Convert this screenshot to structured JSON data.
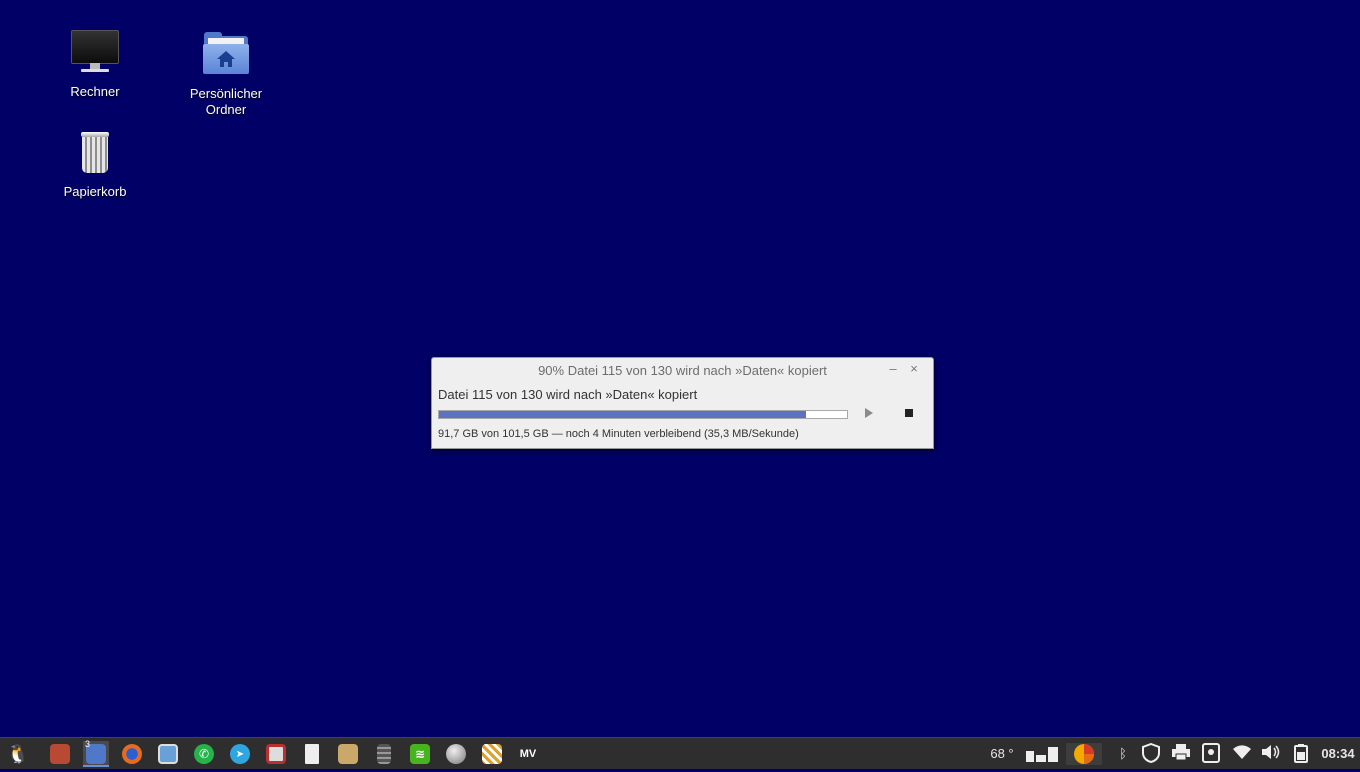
{
  "desktop": {
    "background_color": "#000066",
    "icons": [
      {
        "label": "Rechner",
        "icon": "computer-monitor-icon"
      },
      {
        "label": "Persönlicher\nOrdner",
        "label_line1": "Persönlicher",
        "label_line2": "Ordner",
        "icon": "home-folder-icon"
      },
      {
        "label": "Papierkorb",
        "icon": "trash-icon"
      }
    ]
  },
  "dialog": {
    "title": "90% Datei 115 von 130 wird nach »Daten« kopiert",
    "heading": "Datei 115 von 130 wird nach »Daten« kopiert",
    "progress_fraction": 0.9,
    "status": "91,7 GB von 101,5 GB — noch 4 Minuten verbleibend (35,3 MB/Sekunde)",
    "minimize_label": "–",
    "close_label": "×",
    "accent_color": "#5a72c0"
  },
  "taskbar": {
    "apps": [
      {
        "name": "menu-penguin-icon",
        "glyph": "🐧",
        "color": "#2e2e2e"
      },
      {
        "name": "address-book-icon",
        "glyph": "▮",
        "color": "#c0533a"
      },
      {
        "name": "file-manager-icon",
        "glyph": "",
        "color": "#4f78c9",
        "badge": "3"
      },
      {
        "name": "firefox-icon",
        "glyph": "",
        "color": "#e66b1e"
      },
      {
        "name": "screenshot-icon",
        "glyph": "",
        "color": "#6aa0d8"
      },
      {
        "name": "whatsapp-icon",
        "glyph": "✆",
        "color": "#25b34a"
      },
      {
        "name": "telegram-icon",
        "glyph": "➤",
        "color": "#2ea6e0"
      },
      {
        "name": "backup-icon",
        "glyph": "",
        "color": "#b83030"
      },
      {
        "name": "document-icon",
        "glyph": "",
        "color": "#e8e8e8"
      },
      {
        "name": "image-viewer-icon",
        "glyph": "",
        "color": "#c9a86a"
      },
      {
        "name": "calculator-icon",
        "glyph": "",
        "color": "#555"
      },
      {
        "name": "spotify-icon",
        "glyph": "≋",
        "color": "#47b31f"
      },
      {
        "name": "globe-icon",
        "glyph": "",
        "color": "#aaa"
      },
      {
        "name": "clapperboard-icon",
        "glyph": "",
        "color": "#e0a030"
      },
      {
        "name": "mediathek-icon",
        "glyph": "MV",
        "color": "#2e2e2e"
      }
    ],
    "tray": {
      "temperature": "68 °",
      "clock": "08:34"
    }
  }
}
